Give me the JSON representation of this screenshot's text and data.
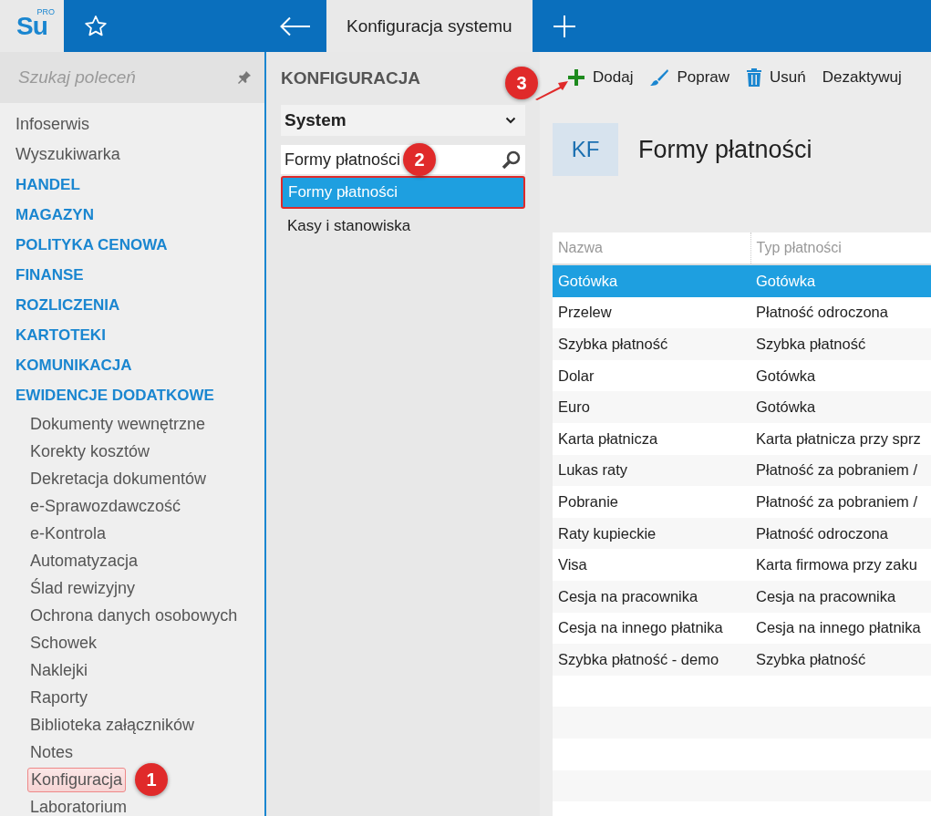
{
  "app": {
    "logo": "Su",
    "logo_badge": "PRO"
  },
  "tabs": [
    {
      "label": "Konfiguracja systemu",
      "selected": true
    }
  ],
  "sidebar": {
    "search": {
      "placeholder": "Szukaj poleceń"
    },
    "items": [
      {
        "label": "Infoserwis",
        "kind": "link"
      },
      {
        "label": "Wyszukiwarka",
        "kind": "link"
      },
      {
        "label": "HANDEL",
        "kind": "section"
      },
      {
        "label": "MAGAZYN",
        "kind": "section"
      },
      {
        "label": "POLITYKA CENOWA",
        "kind": "section"
      },
      {
        "label": "FINANSE",
        "kind": "section"
      },
      {
        "label": "ROZLICZENIA",
        "kind": "section"
      },
      {
        "label": "KARTOTEKI",
        "kind": "section"
      },
      {
        "label": "KOMUNIKACJA",
        "kind": "section"
      },
      {
        "label": "EWIDENCJE DODATKOWE",
        "kind": "section",
        "children": [
          {
            "label": "Dokumenty wewnętrzne",
            "highlighted": false
          },
          {
            "label": "Korekty kosztów",
            "highlighted": false
          },
          {
            "label": "Dekretacja dokumentów",
            "highlighted": false
          },
          {
            "label": "e-Sprawozdawczość",
            "highlighted": false
          },
          {
            "label": "e-Kontrola",
            "highlighted": false
          },
          {
            "label": "Automatyzacja",
            "highlighted": false
          },
          {
            "label": "Ślad rewizyjny",
            "highlighted": false
          },
          {
            "label": "Ochrona danych osobowych",
            "highlighted": false
          },
          {
            "label": "Schowek",
            "highlighted": false
          },
          {
            "label": "Naklejki",
            "highlighted": false
          },
          {
            "label": "Raporty",
            "highlighted": false
          },
          {
            "label": "Biblioteka załączników",
            "highlighted": false
          },
          {
            "label": "Notes",
            "highlighted": false
          },
          {
            "label": "Konfiguracja",
            "highlighted": true,
            "callout": "1"
          },
          {
            "label": "Laboratorium",
            "highlighted": false
          }
        ]
      }
    ]
  },
  "config_panel": {
    "title": "KONFIGURACJA",
    "dropdown": "System",
    "search": {
      "value": "Formy płatności",
      "callout": "2"
    },
    "items": [
      {
        "label": "Formy płatności",
        "selected": true,
        "highlighted": true
      },
      {
        "label": "Kasy i stanowiska",
        "selected": false,
        "highlighted": false
      }
    ]
  },
  "toolbar": {
    "callout": "3",
    "buttons": [
      "Dodaj",
      "Popraw",
      "Usuń",
      "Dezaktywuj"
    ]
  },
  "header": {
    "tile": "KF",
    "title": "Formy płatności"
  },
  "table": {
    "columns": [
      "Nazwa",
      "Typ płatności"
    ],
    "rows": [
      {
        "cells": [
          "Gotówka",
          "Gotówka"
        ],
        "selected": true
      },
      {
        "cells": [
          "Przelew",
          "Płatność odroczona"
        ],
        "selected": false
      },
      {
        "cells": [
          "Szybka płatność",
          "Szybka płatność"
        ],
        "selected": false
      },
      {
        "cells": [
          "Dolar",
          "Gotówka"
        ],
        "selected": false
      },
      {
        "cells": [
          "Euro",
          "Gotówka"
        ],
        "selected": false
      },
      {
        "cells": [
          "Karta płatnicza",
          "Karta płatnicza przy sprz"
        ],
        "selected": false
      },
      {
        "cells": [
          "Lukas raty",
          "Płatność za pobraniem /"
        ],
        "selected": false
      },
      {
        "cells": [
          "Pobranie",
          "Płatność za pobraniem /"
        ],
        "selected": false
      },
      {
        "cells": [
          "Raty kupieckie",
          "Płatność odroczona"
        ],
        "selected": false
      },
      {
        "cells": [
          "Visa",
          "Karta firmowa przy zaku"
        ],
        "selected": false
      },
      {
        "cells": [
          "Cesja na pracownika",
          "Cesja na pracownika"
        ],
        "selected": false
      },
      {
        "cells": [
          "Cesja na innego płatnika",
          "Cesja na innego płatnika"
        ],
        "selected": false
      },
      {
        "cells": [
          "Szybka płatność - demo",
          "Szybka płatność"
        ],
        "selected": false
      }
    ]
  }
}
